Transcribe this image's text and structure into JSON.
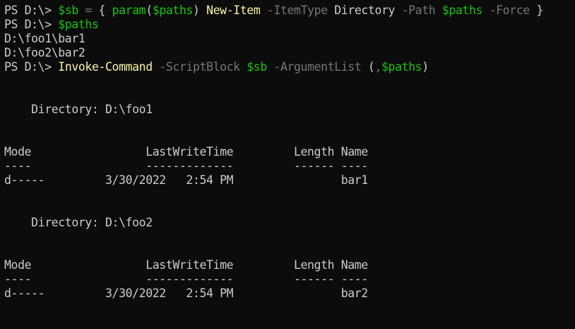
{
  "theme": {
    "background": "#0c0c0c",
    "foreground": "#cccccc",
    "variable": "#16c60c",
    "command": "#f9f1a5",
    "parameter": "#767676"
  },
  "lines": [
    [
      {
        "t": "PS D:\\> ",
        "c": "plain"
      },
      {
        "t": "$sb",
        "c": "var"
      },
      {
        "t": " ",
        "c": "plain"
      },
      {
        "t": "=",
        "c": "op"
      },
      {
        "t": " { ",
        "c": "plain"
      },
      {
        "t": "param",
        "c": "kw"
      },
      {
        "t": "(",
        "c": "plain"
      },
      {
        "t": "$paths",
        "c": "var"
      },
      {
        "t": ") ",
        "c": "plain"
      },
      {
        "t": "New-Item",
        "c": "cmd"
      },
      {
        "t": " ",
        "c": "plain"
      },
      {
        "t": "-ItemType",
        "c": "param"
      },
      {
        "t": " Directory ",
        "c": "plain"
      },
      {
        "t": "-Path",
        "c": "param"
      },
      {
        "t": " ",
        "c": "plain"
      },
      {
        "t": "$paths",
        "c": "var"
      },
      {
        "t": " ",
        "c": "plain"
      },
      {
        "t": "-Force",
        "c": "param"
      },
      {
        "t": " }",
        "c": "plain"
      }
    ],
    [
      {
        "t": "PS D:\\> ",
        "c": "plain"
      },
      {
        "t": "$paths",
        "c": "var"
      }
    ],
    [
      {
        "t": "D:\\foo1\\bar1",
        "c": "plain"
      }
    ],
    [
      {
        "t": "D:\\foo2\\bar2",
        "c": "plain"
      }
    ],
    [
      {
        "t": "PS D:\\> ",
        "c": "plain"
      },
      {
        "t": "Invoke-Command",
        "c": "cmd"
      },
      {
        "t": " ",
        "c": "plain"
      },
      {
        "t": "-ScriptBlock",
        "c": "param"
      },
      {
        "t": " ",
        "c": "plain"
      },
      {
        "t": "$sb",
        "c": "var"
      },
      {
        "t": " ",
        "c": "plain"
      },
      {
        "t": "-ArgumentList",
        "c": "param"
      },
      {
        "t": " (",
        "c": "plain"
      },
      {
        "t": ",",
        "c": "op"
      },
      {
        "t": "$paths",
        "c": "var"
      },
      {
        "t": ")",
        "c": "plain"
      }
    ],
    [],
    [],
    [
      {
        "t": "    Directory: D:\\foo1",
        "c": "plain"
      }
    ],
    [],
    [],
    [
      {
        "t": "Mode                 LastWriteTime         Length Name",
        "c": "plain"
      }
    ],
    [
      {
        "t": "----                 -------------         ------ ----",
        "c": "plain"
      }
    ],
    [
      {
        "t": "d-----         3/30/2022   2:54 PM                bar1",
        "c": "plain"
      }
    ],
    [],
    [],
    [
      {
        "t": "    Directory: D:\\foo2",
        "c": "plain"
      }
    ],
    [],
    [],
    [
      {
        "t": "Mode                 LastWriteTime         Length Name",
        "c": "plain"
      }
    ],
    [
      {
        "t": "----                 -------------         ------ ----",
        "c": "plain"
      }
    ],
    [
      {
        "t": "d-----         3/30/2022   2:54 PM                bar2",
        "c": "plain"
      }
    ]
  ]
}
